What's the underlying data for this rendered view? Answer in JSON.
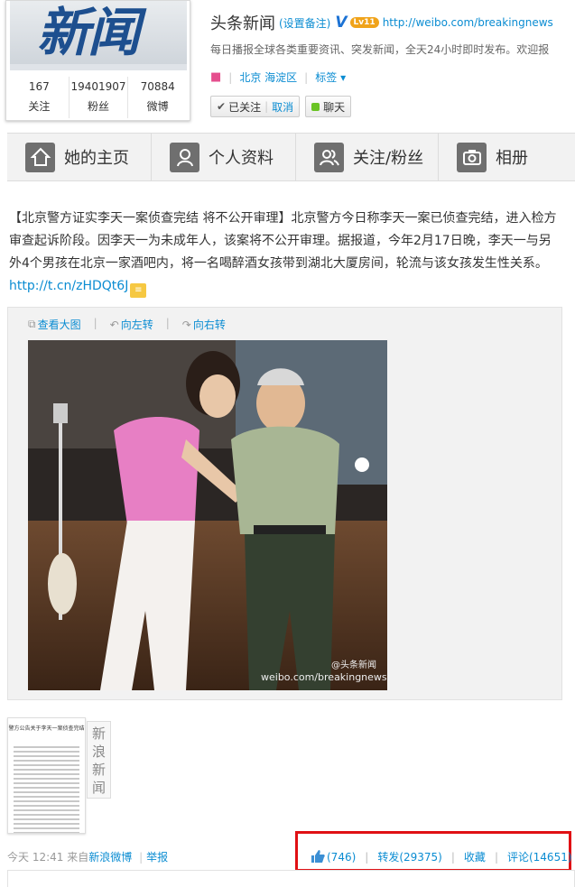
{
  "profile": {
    "avatar_logo_text": "新闻",
    "stats": [
      {
        "num": "167",
        "label": "关注"
      },
      {
        "num": "19401907",
        "label": "粉丝"
      },
      {
        "num": "70884",
        "label": "微博"
      }
    ],
    "name": "头条新闻",
    "remark": "(设置备注)",
    "verified_mark": "V",
    "level_badge": "Lv11",
    "url": "http://weibo.com/breakingnews",
    "intro": "每日播报全球各类重要资讯、突发新闻，全天24小时即时发布。欢迎报",
    "gender_icon": "female-icon",
    "location": "北京 海淀区",
    "tags_label": "标签",
    "followed_label": "已关注",
    "cancel_label": "取消",
    "chat_label": "聊天"
  },
  "tabs": [
    {
      "label": "她的主页",
      "icon": "home-icon"
    },
    {
      "label": "个人资料",
      "icon": "profile-icon"
    },
    {
      "label": "关注/粉丝",
      "icon": "fans-icon"
    },
    {
      "label": "相册",
      "icon": "camera-icon"
    }
  ],
  "post": {
    "text": "【北京警方证实李天一案侦查完结 将不公开审理】北京警方今日称李天一案已侦查完结，进入检方审查起诉阶段。因李天一为未成年人，该案将不公开审理。据报道，今年2月17日晚，李天一与另外4个男孩在北京一家酒吧内，将一名喝醉酒女孩带到湖北大厦房间，轮流与该女孩发生性关系。",
    "link": "http://t.cn/zHDQt6J",
    "media_tools": [
      "查看大图",
      "向左转",
      "向右转"
    ],
    "watermark_handle": "@头条新闻",
    "watermark_url": "weibo.com/breakingnews",
    "thumb_title": "警方公告关于李天一案侦查完结"
  },
  "side_tag": "新浪新闻",
  "footer": {
    "time": "今天 12:41",
    "from_label": "来自",
    "source": "新浪微博",
    "report": "举报"
  },
  "actions": {
    "like": "(746)",
    "repost": "转发(29375)",
    "favorite": "收藏",
    "comment": "评论(14651)"
  },
  "colors": {
    "link": "#0a8cd2",
    "highlight_box": "#e01014",
    "chat_dot": "#6ac324"
  }
}
